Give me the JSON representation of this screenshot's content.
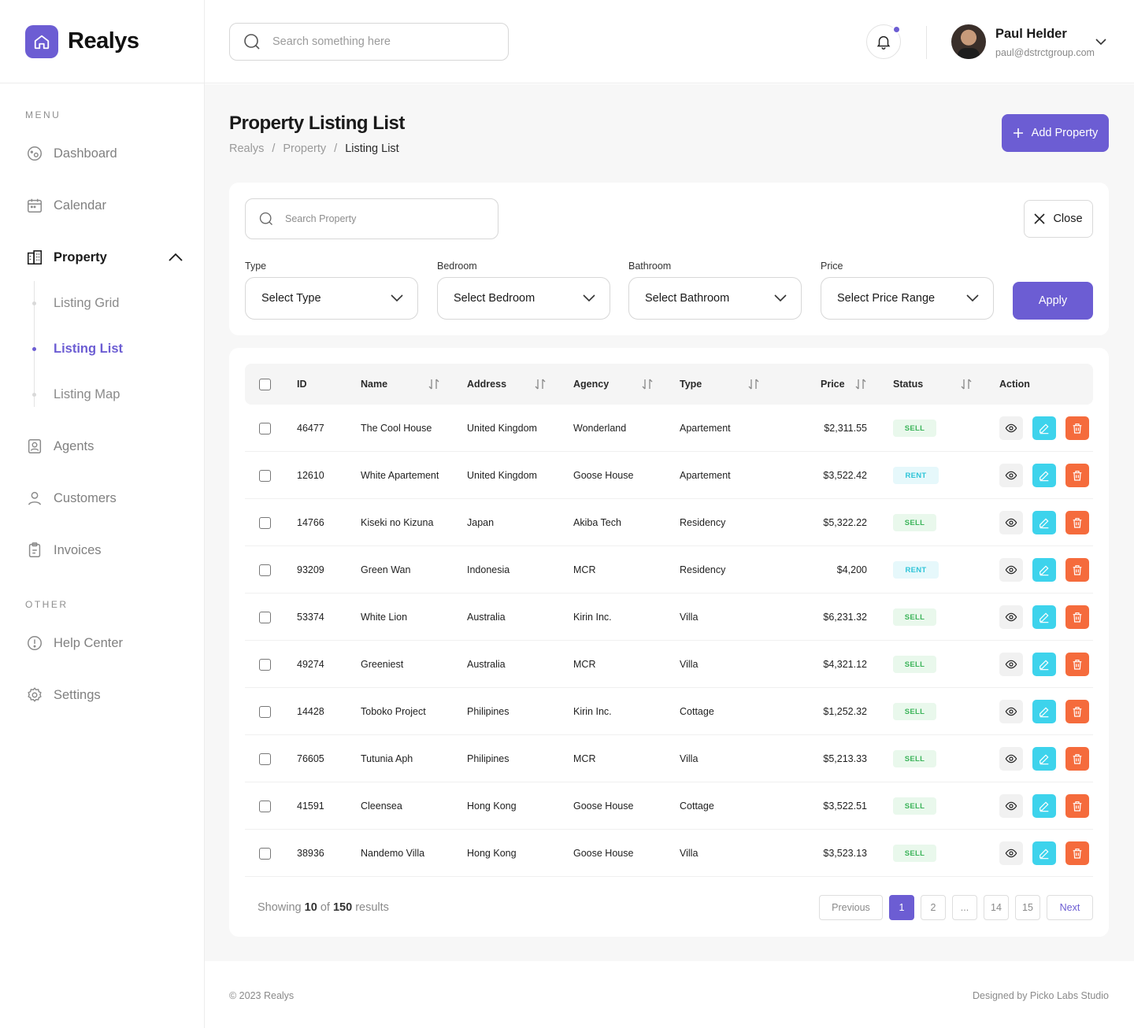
{
  "brand": {
    "name": "Realys",
    "accent": "#6c5dd3"
  },
  "header": {
    "search_placeholder": "Search something here",
    "user": {
      "name": "Paul Helder",
      "email": "paul@dstrctgroup.com"
    }
  },
  "sidebar": {
    "menu_label": "MENU",
    "other_label": "OTHER",
    "items": [
      {
        "label": "Dashboard",
        "icon": "dashboard-icon"
      },
      {
        "label": "Calendar",
        "icon": "calendar-icon"
      },
      {
        "label": "Property",
        "icon": "building-icon",
        "expanded": true
      },
      {
        "label": "Agents",
        "icon": "agent-icon"
      },
      {
        "label": "Customers",
        "icon": "user-icon"
      },
      {
        "label": "Invoices",
        "icon": "clipboard-icon"
      }
    ],
    "sub_items": [
      {
        "label": "Listing Grid"
      },
      {
        "label": "Listing List",
        "active": true
      },
      {
        "label": "Listing Map"
      }
    ],
    "other_items": [
      {
        "label": "Help Center",
        "icon": "help-icon"
      },
      {
        "label": "Settings",
        "icon": "gear-icon"
      }
    ]
  },
  "page": {
    "title": "Property Listing List",
    "breadcrumb": [
      "Realys",
      "Property",
      "Listing List"
    ],
    "add_button": "Add Property"
  },
  "filters": {
    "search_placeholder": "Search Property",
    "close_label": "Close",
    "apply_label": "Apply",
    "fields": [
      {
        "label": "Type",
        "value": "Select Type"
      },
      {
        "label": "Bedroom",
        "value": "Select Bedroom"
      },
      {
        "label": "Bathroom",
        "value": "Select Bathroom"
      },
      {
        "label": "Price",
        "value": "Select Price Range"
      }
    ]
  },
  "table": {
    "columns": [
      "ID",
      "Name",
      "Address",
      "Agency",
      "Type",
      "Price",
      "Status",
      "Action"
    ],
    "rows": [
      {
        "id": "46477",
        "name": "The Cool House",
        "address": "United Kingdom",
        "agency": "Wonderland",
        "type": "Apartement",
        "price": "$2,311.55",
        "status": "SELL"
      },
      {
        "id": "12610",
        "name": "White Apartement",
        "address": "United Kingdom",
        "agency": "Goose House",
        "type": "Apartement",
        "price": "$3,522.42",
        "status": "RENT"
      },
      {
        "id": "14766",
        "name": "Kiseki no Kizuna",
        "address": "Japan",
        "agency": "Akiba Tech",
        "type": "Residency",
        "price": "$5,322.22",
        "status": "SELL"
      },
      {
        "id": "93209",
        "name": "Green Wan",
        "address": "Indonesia",
        "agency": "MCR",
        "type": "Residency",
        "price": "$4,200",
        "status": "RENT"
      },
      {
        "id": "53374",
        "name": "White Lion",
        "address": "Australia",
        "agency": "Kirin Inc.",
        "type": "Villa",
        "price": "$6,231.32",
        "status": "SELL"
      },
      {
        "id": "49274",
        "name": "Greeniest",
        "address": "Australia",
        "agency": "MCR",
        "type": "Villa",
        "price": "$4,321.12",
        "status": "SELL"
      },
      {
        "id": "14428",
        "name": "Toboko Project",
        "address": "Philipines",
        "agency": "Kirin Inc.",
        "type": "Cottage",
        "price": "$1,252.32",
        "status": "SELL"
      },
      {
        "id": "76605",
        "name": "Tutunia Aph",
        "address": "Philipines",
        "agency": "MCR",
        "type": "Villa",
        "price": "$5,213.33",
        "status": "SELL"
      },
      {
        "id": "41591",
        "name": "Cleensea",
        "address": "Hong Kong",
        "agency": "Goose House",
        "type": "Cottage",
        "price": "$3,522.51",
        "status": "SELL"
      },
      {
        "id": "38936",
        "name": "Nandemo Villa",
        "address": "Hong Kong",
        "agency": "Goose House",
        "type": "Villa",
        "price": "$3,523.13",
        "status": "SELL"
      }
    ]
  },
  "pagination": {
    "showing_prefix": "Showing",
    "shown": "10",
    "of": "of",
    "total": "150",
    "suffix": "results",
    "previous": "Previous",
    "next": "Next",
    "pages": [
      "1",
      "2",
      "...",
      "14",
      "15"
    ],
    "current": "1"
  },
  "footer": {
    "copyright": "© 2023 Realys",
    "credit": "Designed by Picko Labs Studio"
  }
}
